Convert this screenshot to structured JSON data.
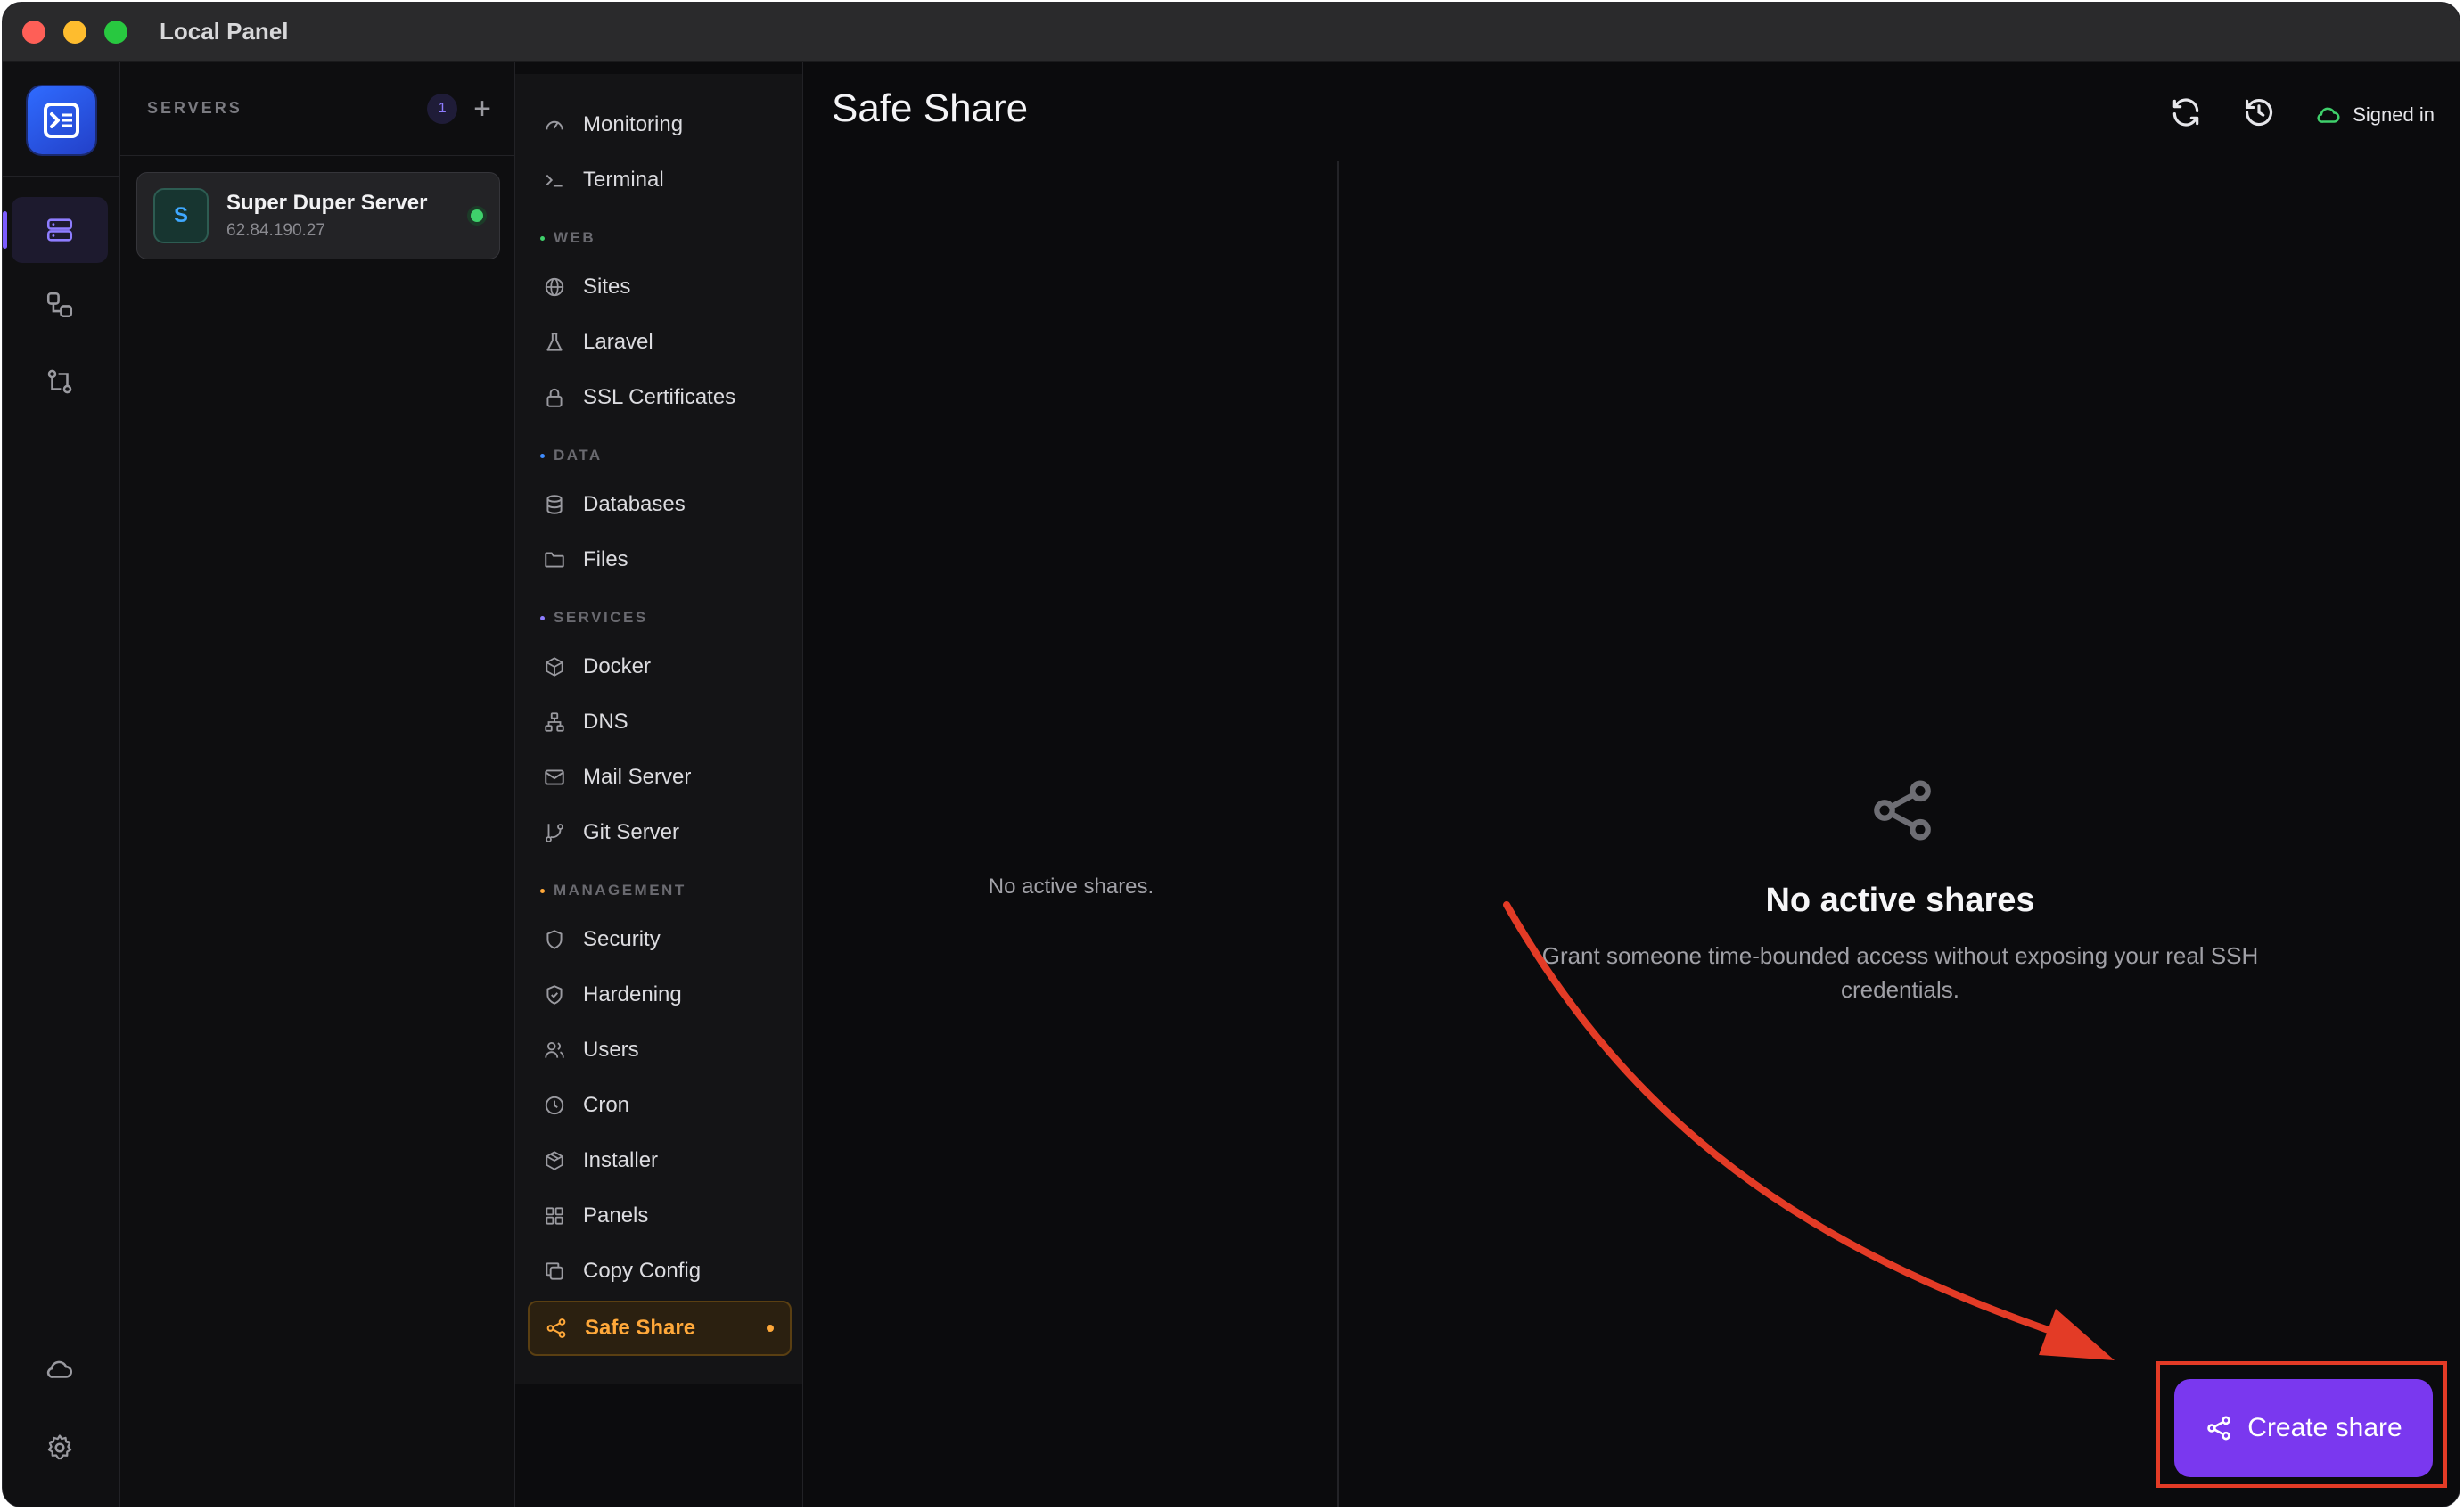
{
  "window": {
    "title": "Local Panel"
  },
  "servers": {
    "heading": "SERVERS",
    "count": "1",
    "add_label": "+",
    "items": [
      {
        "initial": "S",
        "name": "Super Duper Server",
        "ip": "62.84.190.27",
        "status": "online"
      }
    ]
  },
  "nav": {
    "items": [
      {
        "label": "Monitoring",
        "icon": "gauge-icon"
      },
      {
        "label": "Terminal",
        "icon": "terminal-icon"
      }
    ],
    "sections": [
      {
        "label": "WEB",
        "color": "#3fd06b",
        "items": [
          {
            "label": "Sites",
            "icon": "globe-icon"
          },
          {
            "label": "Laravel",
            "icon": "flask-icon"
          },
          {
            "label": "SSL Certificates",
            "icon": "lock-icon"
          }
        ]
      },
      {
        "label": "DATA",
        "color": "#3f8cff",
        "items": [
          {
            "label": "Databases",
            "icon": "database-icon"
          },
          {
            "label": "Files",
            "icon": "folder-icon"
          }
        ]
      },
      {
        "label": "SERVICES",
        "color": "#8e7dff",
        "items": [
          {
            "label": "Docker",
            "icon": "box-icon"
          },
          {
            "label": "DNS",
            "icon": "network-icon"
          },
          {
            "label": "Mail Server",
            "icon": "mail-icon"
          },
          {
            "label": "Git Server",
            "icon": "git-branch-icon"
          }
        ]
      },
      {
        "label": "MANAGEMENT",
        "color": "#ffa83a",
        "items": [
          {
            "label": "Security",
            "icon": "shield-icon"
          },
          {
            "label": "Hardening",
            "icon": "shield-check-icon"
          },
          {
            "label": "Users",
            "icon": "users-icon"
          },
          {
            "label": "Cron",
            "icon": "clock-icon"
          },
          {
            "label": "Installer",
            "icon": "package-icon"
          },
          {
            "label": "Panels",
            "icon": "grid-icon"
          },
          {
            "label": "Copy Config",
            "icon": "copy-icon"
          },
          {
            "label": "Safe Share",
            "icon": "share-icon",
            "active": true
          }
        ]
      }
    ]
  },
  "main": {
    "title": "Safe Share",
    "signed_label": "Signed in",
    "list_empty": "No active shares.",
    "empty_title": "No active shares",
    "empty_desc": "Grant someone time-bounded access without exposing your real SSH credentials.",
    "create_label": "Create share"
  },
  "colors": {
    "accent": "#7a38ef",
    "active_nav": "#ffa83a",
    "online": "#3fd06b",
    "annotation": "#e33b26"
  }
}
